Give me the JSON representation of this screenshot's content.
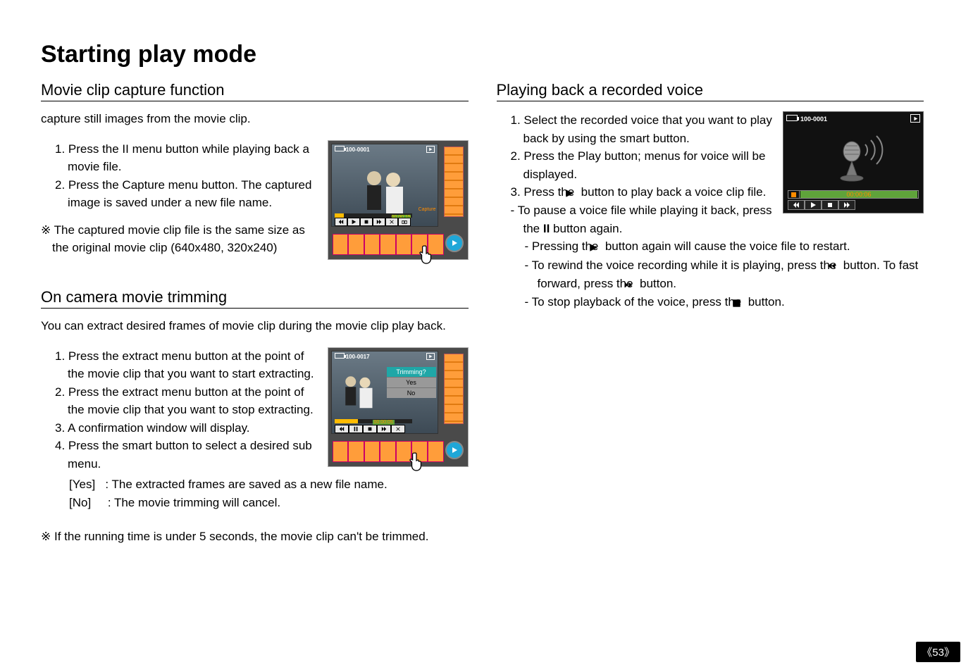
{
  "pageTitle": "Starting play mode",
  "pageNumber": "53",
  "section1": {
    "heading": "Movie clip capture function",
    "intro": "capture still images from the movie clip.",
    "step1": "1. Press the II menu button while playing back a movie file.",
    "step2": "2. Press the Capture menu button. The captured image is saved under a new file name.",
    "note": "※ The captured movie clip file is the same size as the original movie clip (640x480, 320x240)"
  },
  "fig1": {
    "fileId": "100-0001",
    "time": "00:00:15",
    "capture": "Capture"
  },
  "section2": {
    "heading": "On camera movie trimming",
    "intro": "You can extract desired frames of movie clip during the movie clip play back.",
    "step1": "1. Press the extract menu button at the point of the movie clip that you want to start extracting.",
    "step2": "2. Press the extract menu button at the point of the movie clip that you want to stop extracting.",
    "step3": "3. A confirmation window will display.",
    "step4": "4. Press the smart button to select a desired sub menu.",
    "yesLabel": "[Yes]",
    "yesDesc": ": The extracted frames are saved as a new file name.",
    "noLabel": "[No]",
    "noDesc": ": The movie trimming will cancel.",
    "note": "※ If the running time is under 5 seconds, the movie clip can't be trimmed."
  },
  "fig2": {
    "fileId": "100-0017",
    "menuTitle": "Trimming?",
    "menuYes": "Yes",
    "menuNo": "No",
    "time": "00:00:05"
  },
  "section3": {
    "heading": "Playing back a recorded voice",
    "step1": "1. Select the recorded voice that you want to play back by using the smart button.",
    "step2": "2. Press the Play button; menus for voice will be displayed.",
    "step3a": "3. Press the ",
    "step3b": " button to play back a voice clip file.",
    "pauseA": "- To pause a voice file while playing it back, press the ",
    "pauseB": "II",
    "pauseC": " button again.",
    "restartA": "- Pressing the ",
    "restartB": " button again will cause the voice file to restart.",
    "rewindA": "- To rewind the voice recording while it is playing, press the ",
    "rewindB": " button. To fast forward, press the ",
    "rewindC": " button.",
    "stopA": "- To stop playback of the voice, press the ",
    "stopB": " button."
  },
  "fig3": {
    "fileId": "100-0001",
    "time": "00:00:06"
  }
}
